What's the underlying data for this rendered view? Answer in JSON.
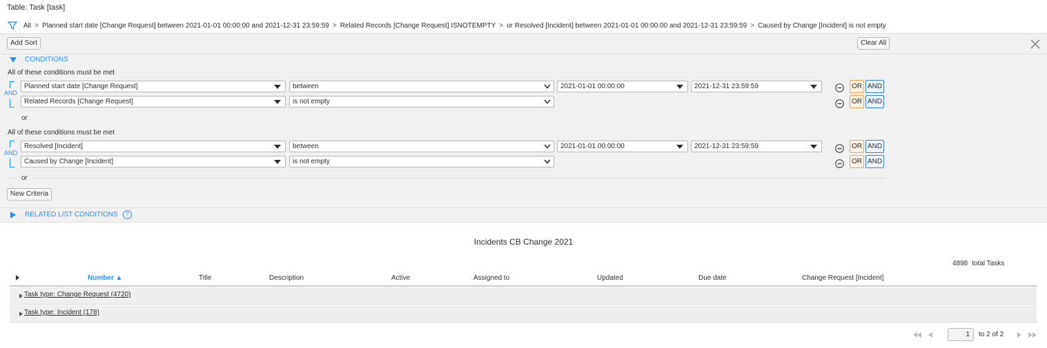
{
  "table_title": "Table: Task [task]",
  "breadcrumb": [
    "All",
    "Planned start date [Change Request] between 2021-01-01 00:00:00 and 2021-12-31 23:59:59",
    "Related Records [Change Request] ISNOTEMPTY",
    "or Resolved [Incident] between 2021-01-01 00:00:00 and 2021-12-31 23:59:59",
    "Caused by Change [Incident] is not empty"
  ],
  "breadcrumb_sep": ">",
  "toolbar": {
    "add_sort": "Add Sort",
    "clear_all": "Clear All"
  },
  "conditions": {
    "header": "CONDITIONS",
    "all_met": "All of these conditions must be met",
    "and_label": "AND",
    "or_label": "or",
    "or_btn": "OR",
    "and_btn": "AND",
    "groups": [
      {
        "rows": [
          {
            "field": "Planned start date [Change Request]",
            "operator": "between",
            "from": "2021-01-01 00:00:00",
            "to": "2021-12-31 23:59:59"
          },
          {
            "field": "Related Records [Change Request]",
            "operator": "is not empty"
          }
        ]
      },
      {
        "rows": [
          {
            "field": "Resolved [Incident]",
            "operator": "between",
            "from": "2021-01-01 00:00:00",
            "to": "2021-12-31 23:59:59"
          },
          {
            "field": "Caused by Change [Incident]",
            "operator": "is not empty"
          }
        ]
      }
    ],
    "new_criteria": "New Criteria",
    "related_list": "RELATED LIST CONDITIONS",
    "help": "?"
  },
  "list": {
    "title": "Incidents CB Change 2021",
    "total_count": "4898",
    "total_label": "total Tasks",
    "columns": [
      "Number ▲",
      "Title",
      "Description",
      "Active",
      "Assigned to",
      "Updated",
      "Due date",
      "Change Request [Incident]"
    ],
    "groups": [
      "Task type: Change Request (4720)",
      "Task type: Incident (178)"
    ]
  },
  "pager": {
    "page": "1",
    "of_text": "to 2 of 2"
  },
  "colors": {
    "accent": "#278efc",
    "or_fill": "#fdf0e0",
    "or_border": "#e8a65a",
    "and_fill": "#eaf4ff",
    "and_border": "#3b7fd0",
    "panel_bg": "#f1f1f1"
  },
  "icons": [
    "filter-icon",
    "close-icon",
    "chevron-down-icon",
    "minus-circle-icon",
    "help-icon",
    "first-page-icon",
    "prev-page-icon",
    "next-page-icon",
    "last-page-icon"
  ]
}
